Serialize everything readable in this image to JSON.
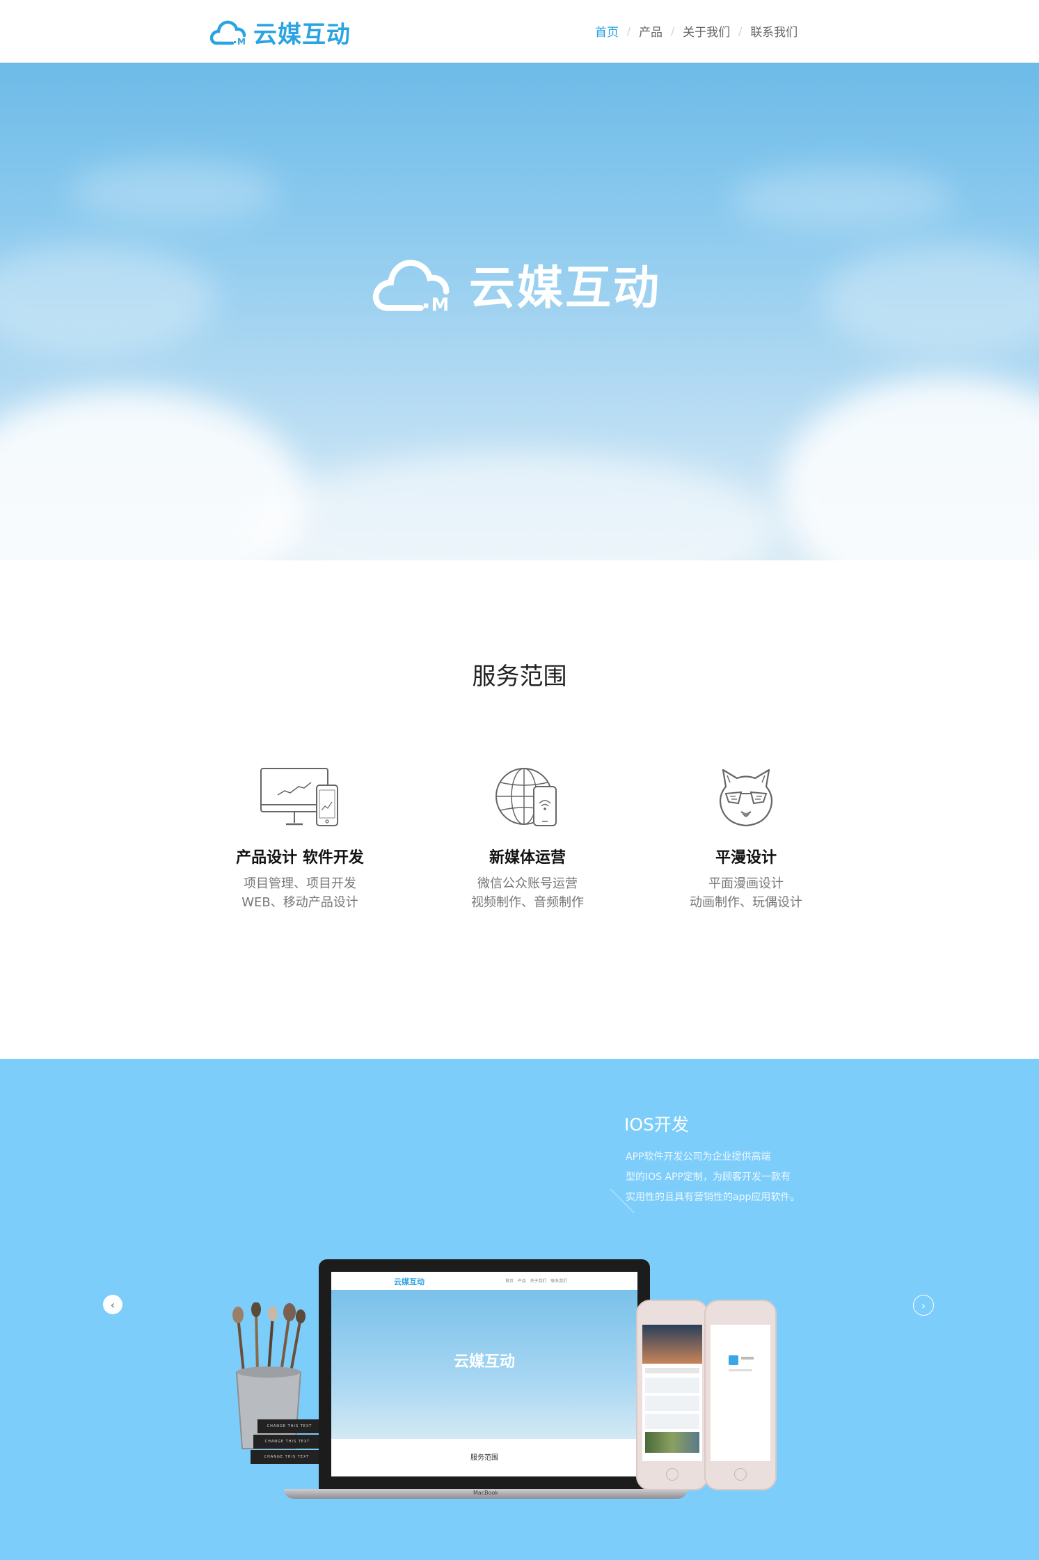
{
  "header": {
    "logo_text": "云媒互动",
    "nav": [
      {
        "label": "首页",
        "active": true
      },
      {
        "label": "产品",
        "active": false
      },
      {
        "label": "关于我们",
        "active": false
      },
      {
        "label": "联系我们",
        "active": false
      }
    ]
  },
  "hero": {
    "logo_text": "云媒互动"
  },
  "services": {
    "title": "服务范围",
    "items": [
      {
        "title": "产品设计  软件开发",
        "line1": "项目管理、项目开发",
        "line2": "WEB、移动产品设计",
        "icon": "monitor-phone-icon"
      },
      {
        "title": "新媒体运营",
        "line1": "微信公众账号运营",
        "line2": "视频制作、音频制作",
        "icon": "globe-phone-icon"
      },
      {
        "title": "平漫设计",
        "line1": "平面漫画设计",
        "line2": "动画制作、玩偶设计",
        "icon": "cartoon-cat-icon"
      }
    ]
  },
  "showcase": {
    "title": "IOS开发",
    "desc_lines": [
      "APP软件开发公司为企业提供高端",
      "型的IOS APP定制，为顾客开发一款有",
      "实用性的且具有营销性的app应用软件。"
    ],
    "laptop_logo": "云媒互动",
    "laptop_hero_text": "云媒互动",
    "laptop_sub": "服务范围",
    "laptop_brand": "MacBook",
    "book_label": "CHANGE THIS TEXT",
    "colors": {
      "background": "#7dcdfb",
      "accent": "#27a0df"
    }
  }
}
